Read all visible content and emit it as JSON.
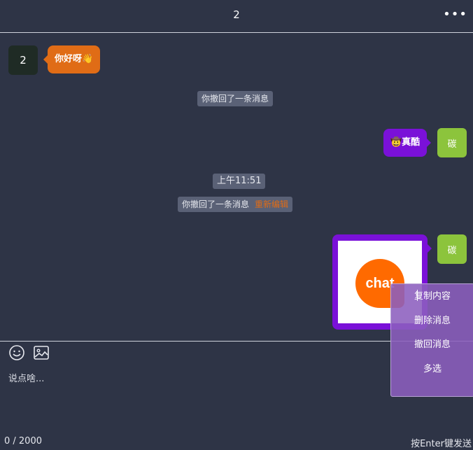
{
  "header": {
    "title": "2",
    "more_icon": "ellipsis-icon",
    "more_label": "•••"
  },
  "messages": {
    "incoming_1": {
      "avatar": "2",
      "text": "你好呀👋"
    },
    "recall_1": {
      "text": "你撤回了一条消息"
    },
    "outgoing_1": {
      "avatar": "碳",
      "text": "🤠真酷"
    },
    "timestamp": {
      "text": "上午11:51"
    },
    "recall_2": {
      "text": "你撤回了一条消息",
      "action": "重新编辑"
    },
    "outgoing_2": {
      "avatar": "碳",
      "image_text": "chat"
    }
  },
  "toolbar": {
    "emoji_icon": "emoji-icon",
    "image_icon": "image-icon"
  },
  "input": {
    "placeholder": "说点啥...",
    "counter": "0 / 2000",
    "send_hint": "按Enter键发送"
  },
  "context_menu": {
    "items": [
      "复制内容",
      "删除消息",
      "撤回消息",
      "多选"
    ]
  },
  "colors": {
    "background": "#2e3446",
    "accent_orange": "#e06c16",
    "accent_purple": "#7a11d8",
    "avatar_green": "#8cc43c"
  }
}
